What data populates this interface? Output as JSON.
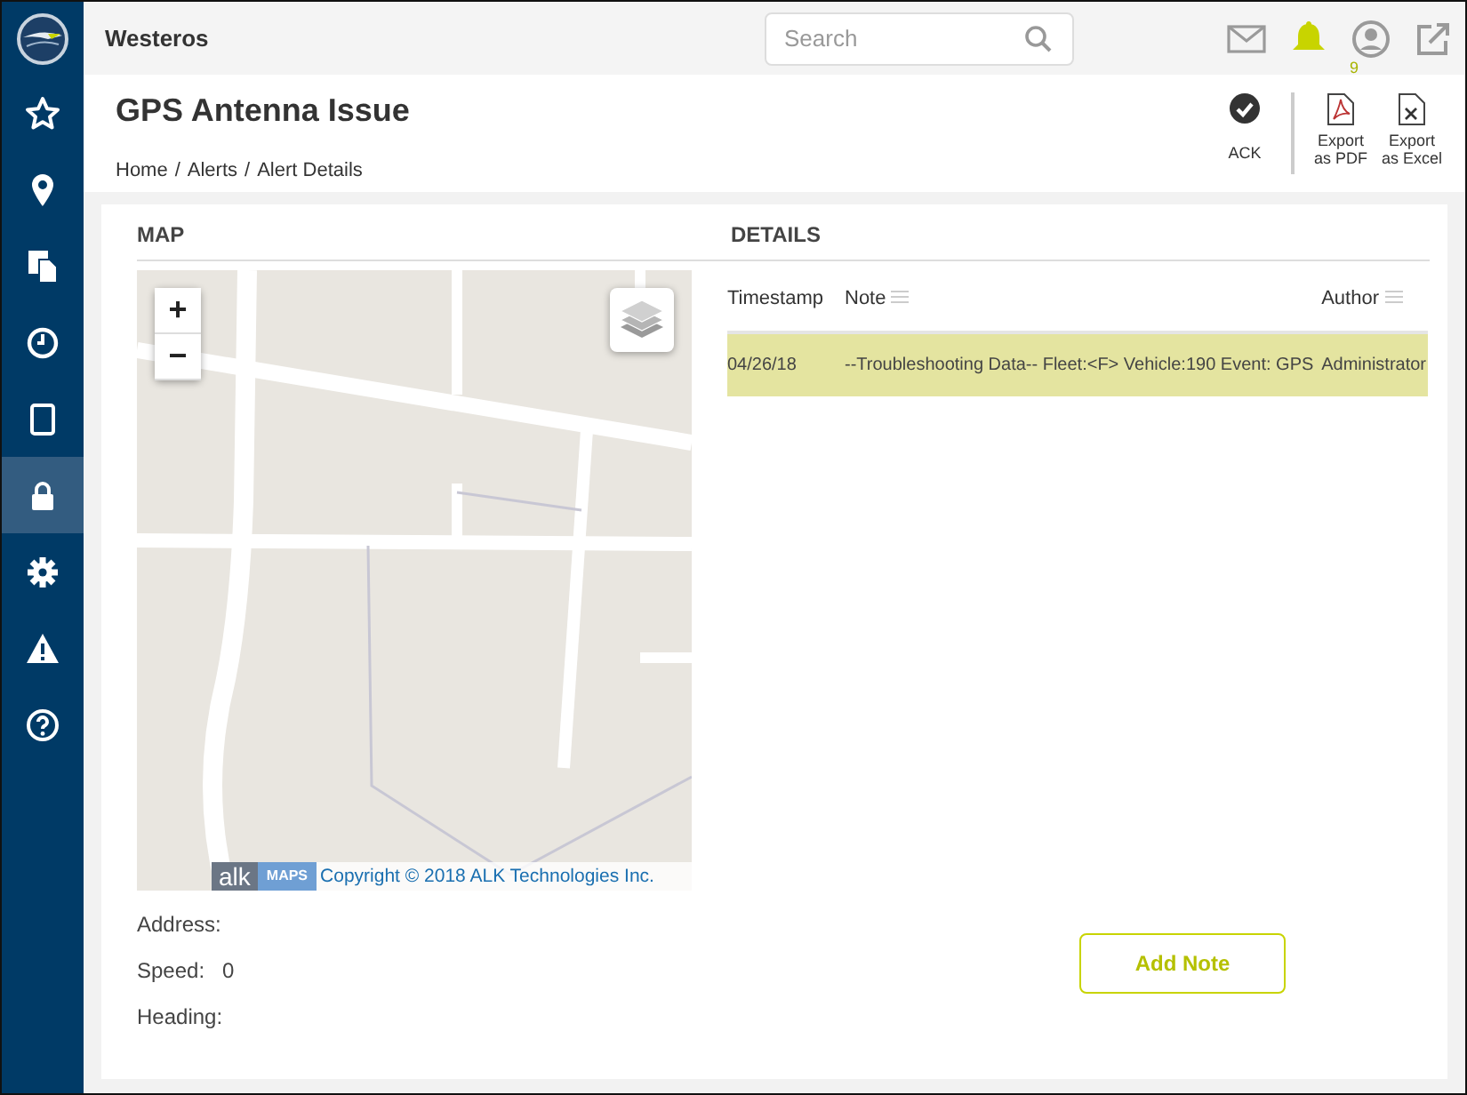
{
  "app": {
    "title": "Westeros"
  },
  "sidebar": {
    "items": [
      {
        "selected": false
      },
      {
        "selected": false
      },
      {
        "selected": false
      },
      {
        "selected": false
      },
      {
        "selected": false
      },
      {
        "selected": true
      },
      {
        "selected": false
      },
      {
        "selected": false
      },
      {
        "selected": false
      }
    ]
  },
  "search": {
    "placeholder": "Search"
  },
  "notifications": {
    "count": "9"
  },
  "page": {
    "title": "GPS Antenna Issue",
    "breadcrumb": [
      "Home",
      "Alerts",
      "Alert Details"
    ],
    "breadcrumb_separator": "/"
  },
  "actions": [
    {
      "kind": "ack",
      "label": "ACK"
    },
    {
      "kind": "pdf",
      "label": "Export as PDF"
    },
    {
      "kind": "excel",
      "label": "Export as Excel"
    }
  ],
  "map": {
    "heading": "MAP",
    "zoom_in": "+",
    "zoom_out": "−",
    "logo": "alk",
    "logo_badge": "MAPS",
    "copyright": "Copyright © 2018 ALK Technologies Inc."
  },
  "fields": [
    {
      "label": "Address:"
    },
    {
      "label": "Speed:",
      "value": "0"
    },
    {
      "label": "Heading:"
    }
  ],
  "details": {
    "heading": "DETAILS",
    "columns": [
      "Timestamp",
      "Note",
      "Author"
    ],
    "rows": [
      {
        "timestamp": "04/26/18",
        "note": "--Troubleshooting Data-- Fleet:<F> Vehicle:190 Event: GPS",
        "author": "Administrator",
        "selected": true
      }
    ]
  },
  "add_note": "Add Note"
}
